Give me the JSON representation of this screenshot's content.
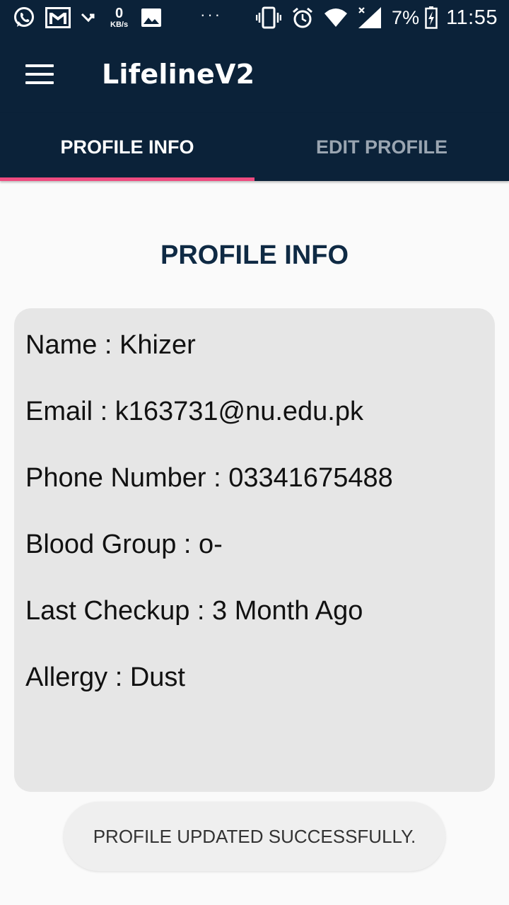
{
  "status_bar": {
    "net_speed_value": "0",
    "net_speed_unit": "KB/s",
    "dots": "···",
    "battery_percent": "7%",
    "time": "11:55"
  },
  "app_bar": {
    "title": "LifelineV2"
  },
  "tabs": [
    {
      "label": "PROFILE INFO",
      "active": true
    },
    {
      "label": "EDIT PROFILE",
      "active": false
    }
  ],
  "main": {
    "heading": "PROFILE INFO",
    "profile": {
      "name": "Name : Khizer",
      "email": "Email : k163731@nu.edu.pk",
      "phone": "Phone Number : 03341675488",
      "blood_group": "Blood Group : o-",
      "last_checkup": "Last Checkup : 3 Month Ago",
      "allergy": "Allergy : Dust"
    }
  },
  "toast": {
    "message": "PROFILE UPDATED SUCCESSFULLY."
  },
  "colors": {
    "primary_dark": "#0b2239",
    "tab_indicator": "#ee4b7f",
    "heading_text": "#0f2a44",
    "card_background": "#e6e6e6"
  },
  "icons": [
    "whatsapp-icon",
    "gmail-icon",
    "missed-call-icon",
    "gallery-icon",
    "vibrate-icon",
    "alarm-icon",
    "wifi-icon",
    "signal-icon",
    "battery-charging-icon",
    "menu-icon"
  ]
}
